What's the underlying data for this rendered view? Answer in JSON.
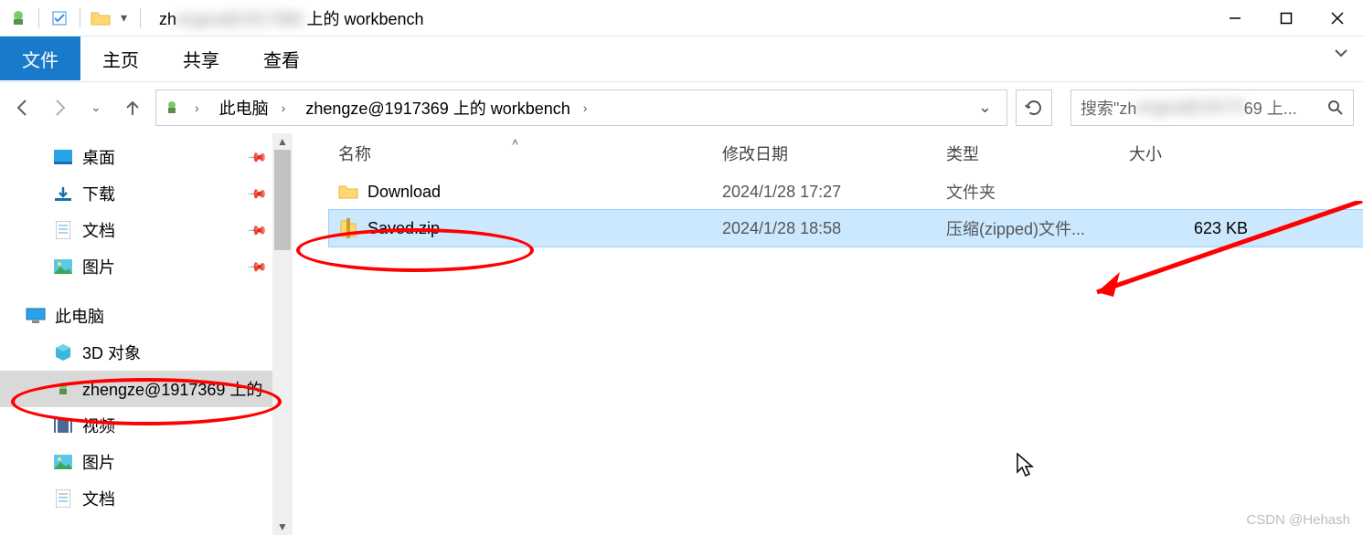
{
  "titlebar": {
    "title_prefix": "zh",
    "title_blurred": "engze@1917369",
    "title_suffix": "上的 workbench"
  },
  "ribbon": {
    "tabs": [
      "文件",
      "主页",
      "共享",
      "查看"
    ],
    "active_index": 0
  },
  "breadcrumb": {
    "items": [
      "此电脑",
      "zhengze@1917369 上的 workbench"
    ]
  },
  "search": {
    "prefix": "搜索\"zh",
    "blurred": "engze@19173",
    "suffix": "69 上..."
  },
  "sidebar": {
    "items": [
      {
        "icon": "desktop",
        "label": "桌面",
        "pinned": true
      },
      {
        "icon": "download",
        "label": "下载",
        "pinned": true
      },
      {
        "icon": "document",
        "label": "文档",
        "pinned": true
      },
      {
        "icon": "picture",
        "label": "图片",
        "pinned": true
      }
    ],
    "thispc_label": "此电脑",
    "thispc_items": [
      {
        "icon": "3d",
        "label": "3D 对象"
      },
      {
        "icon": "remote",
        "label": "zhengze@1917369 上的",
        "selected": true
      },
      {
        "icon": "video",
        "label": "视频"
      },
      {
        "icon": "picture",
        "label": "图片"
      },
      {
        "icon": "document",
        "label": "文档"
      }
    ]
  },
  "columns": {
    "name": "名称",
    "date": "修改日期",
    "type": "类型",
    "size": "大小"
  },
  "files": [
    {
      "icon": "folder",
      "name": "Download",
      "date": "2024/1/28 17:27",
      "type": "文件夹",
      "size": ""
    },
    {
      "icon": "zip",
      "name": "Saved.zip",
      "date": "2024/1/28 18:58",
      "type": "压缩(zipped)文件...",
      "size": "623 KB",
      "selected": true
    }
  ],
  "watermark": "CSDN @Hehash"
}
